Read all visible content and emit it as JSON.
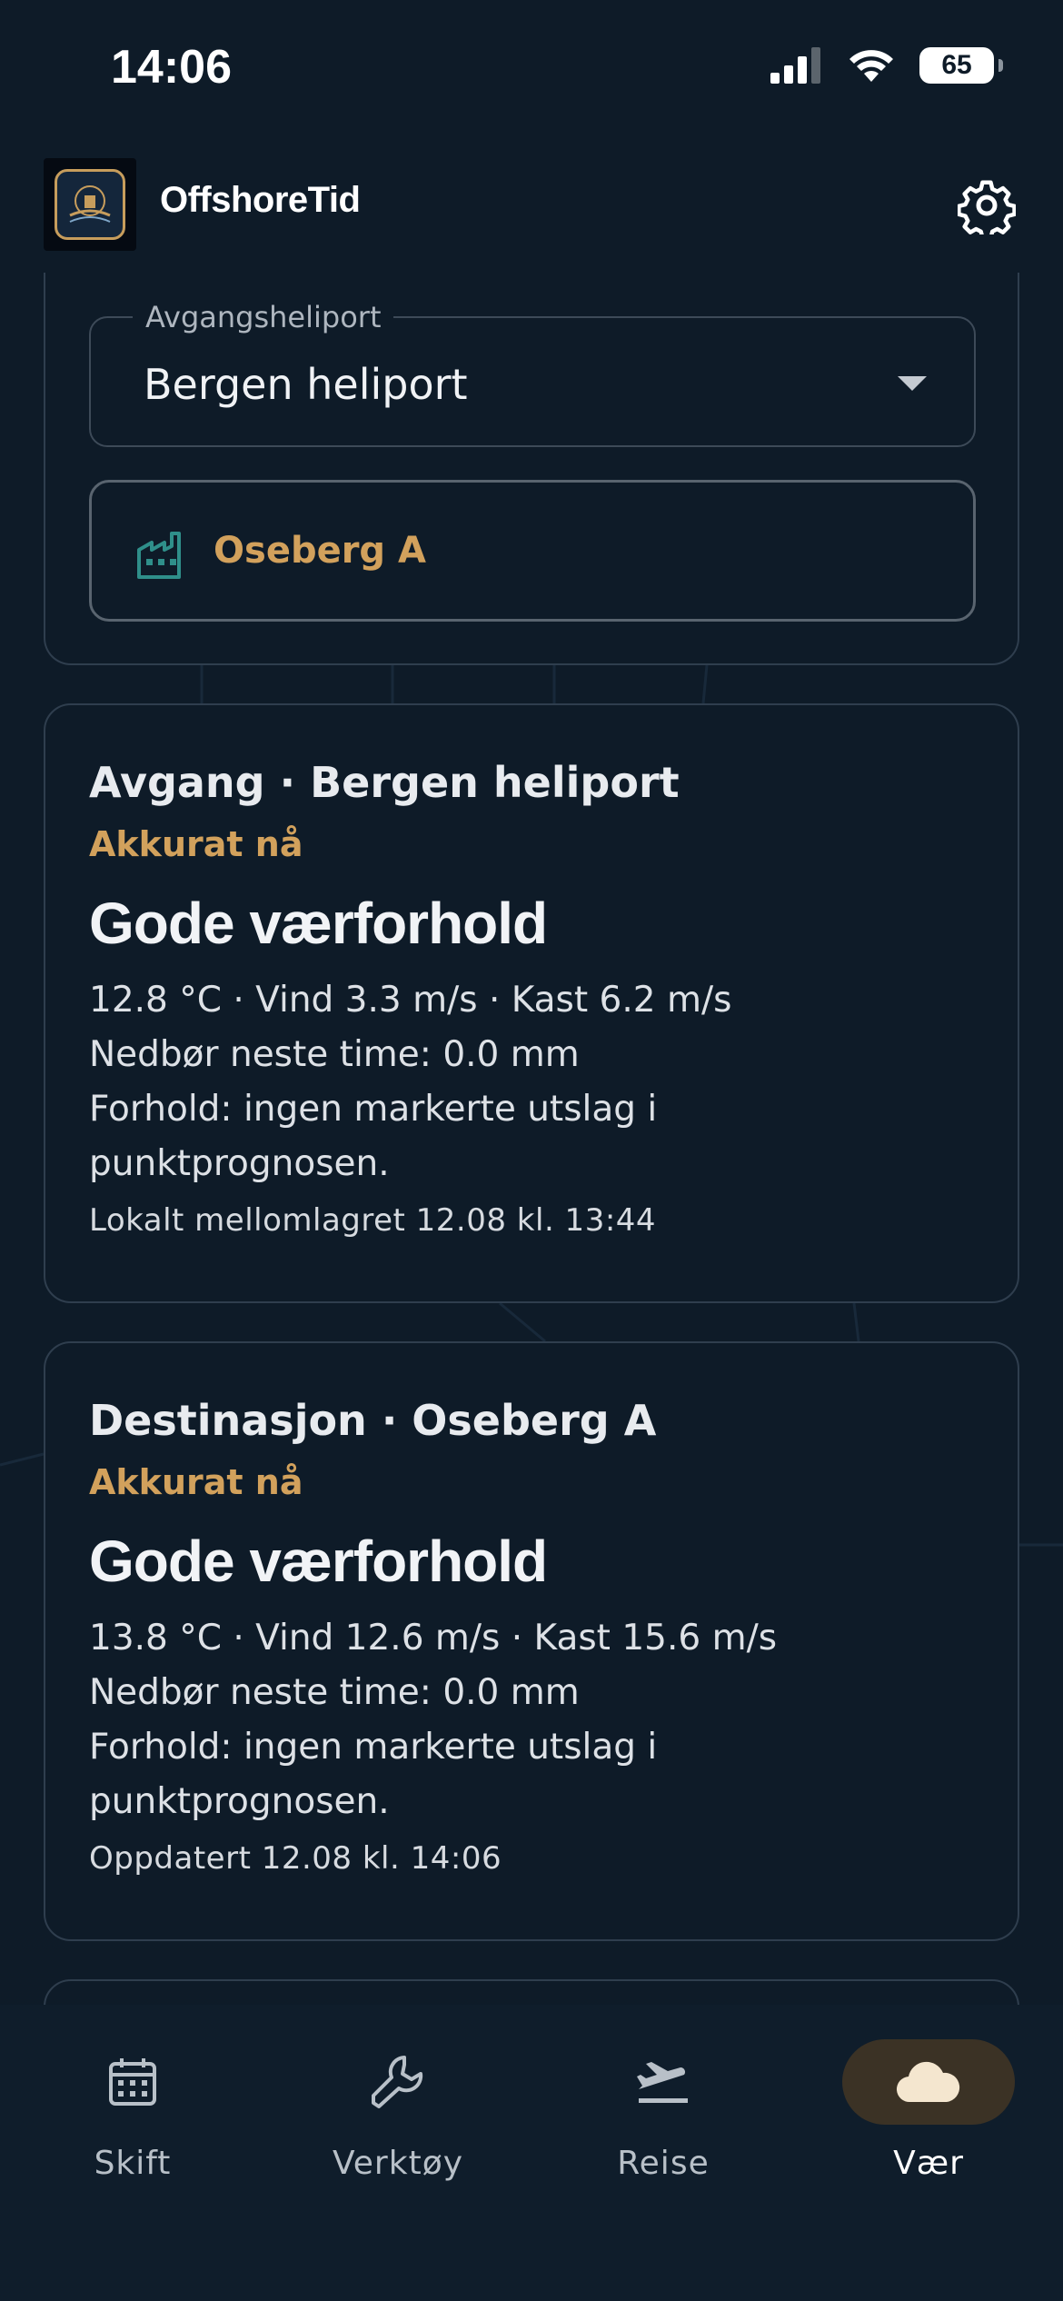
{
  "status": {
    "time": "14:06",
    "battery": "65"
  },
  "header": {
    "app_title": "OffshoreTid"
  },
  "departure_select": {
    "label": "Avgangsheliport",
    "value": "Bergen heliport"
  },
  "destination": {
    "value": "Oseberg A"
  },
  "weather_cards": [
    {
      "heading": "Avgang · Bergen heliport",
      "time_label": "Akkurat nå",
      "condition": "Gode værforhold",
      "line1": "12.8 °C · Vind 3.3 m/s · Kast 6.2 m/s",
      "line2": "Nedbør neste time: 0.0 mm",
      "line3": "Forhold: ingen markerte utslag i",
      "line4": "punktprognosen.",
      "footer": "Lokalt mellomlagret 12.08 kl. 13:44"
    },
    {
      "heading": "Destinasjon · Oseberg A",
      "time_label": "Akkurat nå",
      "condition": "Gode værforhold",
      "line1": "13.8 °C · Vind 12.6 m/s · Kast 15.6 m/s",
      "line2": "Nedbør neste time: 0.0 mm",
      "line3": "Forhold: ingen markerte utslag i",
      "line4": "punktprognosen.",
      "footer": "Oppdatert 12.08 kl. 14:06"
    }
  ],
  "nav": [
    {
      "label": "Skift",
      "icon": "calendar-icon"
    },
    {
      "label": "Verktøy",
      "icon": "wrench-icon"
    },
    {
      "label": "Reise",
      "icon": "plane-departure-icon"
    },
    {
      "label": "Vær",
      "icon": "cloud-icon",
      "active": true
    }
  ],
  "colors": {
    "background": "#0e1b28",
    "accent": "#d2a15c",
    "active_nav_bg": "#3b3225"
  }
}
